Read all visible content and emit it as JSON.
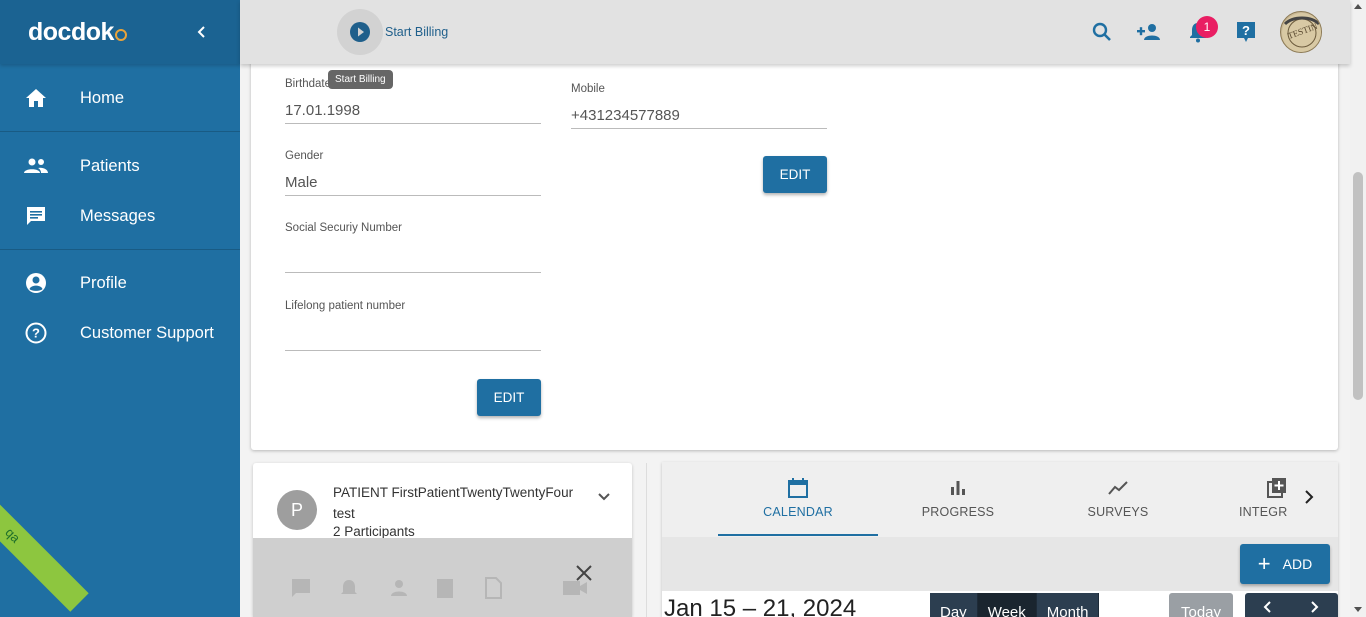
{
  "brand": {
    "name": "docdok"
  },
  "sidebar": {
    "items": [
      {
        "label": "Home",
        "icon": "home-icon"
      },
      {
        "label": "Patients",
        "icon": "people-icon"
      },
      {
        "label": "Messages",
        "icon": "message-icon"
      },
      {
        "label": "Profile",
        "icon": "account-circle-icon"
      },
      {
        "label": "Customer Support",
        "icon": "help-circle-icon"
      }
    ],
    "ribbon": "qa"
  },
  "topbar": {
    "billing_label": "Start Billing",
    "tooltip": "Start Billing",
    "notification_count": "1",
    "avatar_text": "TESTIN"
  },
  "details": {
    "birthdate": {
      "label": "Birthdate",
      "value": "17.01.1998"
    },
    "gender": {
      "label": "Gender",
      "value": "Male"
    },
    "ssn": {
      "label": "Social Securiy Number",
      "value": ""
    },
    "lifelong": {
      "label": "Lifelong patient number",
      "value": ""
    },
    "mobile": {
      "label": "Mobile",
      "value": "+431234577889"
    },
    "edit_label": "EDIT",
    "edit_label_2": "EDIT"
  },
  "chat": {
    "avatar_letter": "P",
    "title": "PATIENT FirstPatientTwentyTwentyFour test",
    "participants": "2 Participants"
  },
  "calendar": {
    "tabs": [
      {
        "label": "CALENDAR",
        "icon": "calendar-icon",
        "active": true
      },
      {
        "label": "PROGRESS",
        "icon": "bar-chart-icon",
        "active": false
      },
      {
        "label": "SURVEYS",
        "icon": "trending-icon",
        "active": false
      },
      {
        "label": "INTEGR",
        "icon": "library-add-icon",
        "active": false
      }
    ],
    "add_label": "ADD",
    "range": "Jan 15 – 21, 2024",
    "views": [
      "Day",
      "Week",
      "Month"
    ],
    "active_view": "Week",
    "today_label": "Today"
  },
  "colors": {
    "primary": "#1f6fa2",
    "sidebar": "#1f6fa2",
    "badge": "#e91e63",
    "ribbon": "#8dc63f"
  }
}
